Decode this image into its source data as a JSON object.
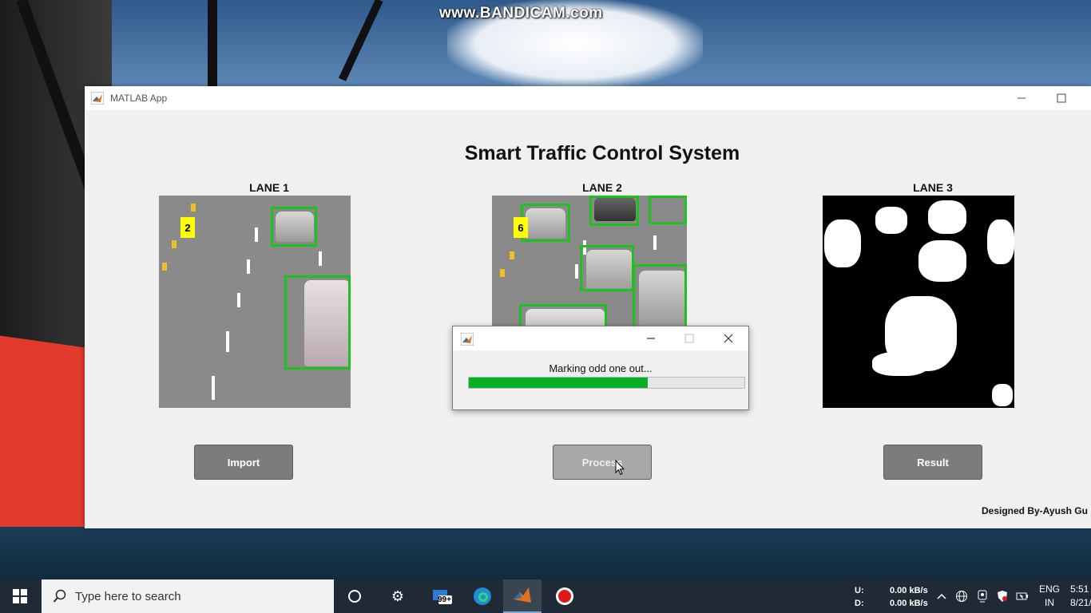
{
  "watermark": "www.BANDICAM.com",
  "window": {
    "title": "MATLAB App"
  },
  "app": {
    "heading": "Smart Traffic Control System",
    "lanes": [
      {
        "label": "LANE 1",
        "vehicle_count": "2"
      },
      {
        "label": "LANE 2",
        "vehicle_count": "6"
      },
      {
        "label": "LANE 3"
      }
    ],
    "buttons": {
      "import": "Import",
      "process": "Process",
      "result": "Result"
    },
    "credit": "Designed By-Ayush Gu"
  },
  "dialog": {
    "message": "Marking odd one out...",
    "progress": 0.65
  },
  "taskbar": {
    "search_placeholder": "Type here to search",
    "mail_badge": "99+",
    "net_upload_label": "U:",
    "net_upload_value": "0.00 kB/s",
    "net_download_label": "D:",
    "net_download_value": "0.00 kB/s",
    "lang_line1": "ENG",
    "lang_line2": "IN",
    "time": "5:51",
    "date": "8/21/"
  },
  "colors": {
    "bbox": "#1ec11e",
    "progress": "#06b025",
    "badge": "#ffff00"
  }
}
